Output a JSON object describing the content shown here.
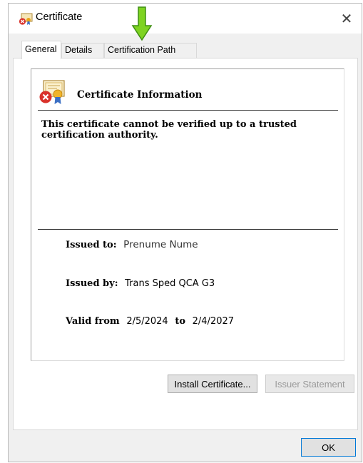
{
  "window": {
    "title": "Certificate",
    "close_glyph": "✕"
  },
  "tabs": [
    {
      "label": "General",
      "active": true
    },
    {
      "label": "Details",
      "active": false
    },
    {
      "label": "Certification Path",
      "active": false
    }
  ],
  "info": {
    "heading": "Certificate Information",
    "warning": "This certificate cannot be verified up to a trusted certification authority.",
    "issued_to_label": "Issued to:",
    "issued_to_value": "Prenume Nume",
    "issued_by_label": "Issued by:",
    "issued_by_value": "Trans Sped QCA G3",
    "valid_from_label": "Valid from",
    "valid_from_value": "2/5/2024",
    "valid_to_label": "to",
    "valid_to_value": "2/4/2027"
  },
  "buttons": {
    "install": "Install Certificate...",
    "issuer": "Issuer Statement",
    "ok": "OK"
  },
  "icons": {
    "title": "certificate-error-icon",
    "info": "certificate-error-icon",
    "annotation": "green-down-arrow-icon"
  },
  "colors": {
    "arrow": "#7ed321",
    "arrow_outline": "#3f8f12",
    "error_badge": "#d9322b",
    "ok_border": "#0078d7"
  }
}
